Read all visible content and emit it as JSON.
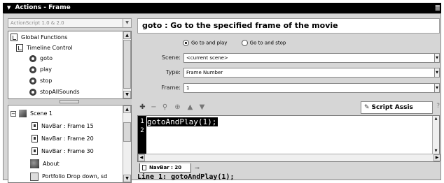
{
  "panel": {
    "title": "Actions - Frame",
    "options_glyph": "≣"
  },
  "toolbox": {
    "version_select": "ActionScript 1.0 & 2.0",
    "items": [
      {
        "label": "Global Functions",
        "icon": "book-icon"
      },
      {
        "label": "Timeline Control",
        "icon": "book-icon"
      },
      {
        "label": "goto",
        "icon": "action-icon"
      },
      {
        "label": "play",
        "icon": "action-icon"
      },
      {
        "label": "stop",
        "icon": "action-icon"
      },
      {
        "label": "stopAllSounds",
        "icon": "action-icon"
      }
    ]
  },
  "script_nav": {
    "items": [
      {
        "label": "Scene 1",
        "icon": "scene-icon"
      },
      {
        "label": "NavBar : Frame 15",
        "icon": "frame-icon"
      },
      {
        "label": "NavBar : Frame 20",
        "icon": "frame-icon"
      },
      {
        "label": "NavBar : Frame 30",
        "icon": "frame-icon"
      },
      {
        "label": "About",
        "icon": "movieclip-icon"
      },
      {
        "label": "Portfolio Drop down, sd",
        "icon": "button-icon"
      }
    ]
  },
  "assist": {
    "header": "goto : Go to the specified frame of the movie",
    "radio_play": "Go to and play",
    "radio_stop": "Go to and stop",
    "scene_label": "Scene:",
    "scene_value": "<current scene>",
    "type_label": "Type:",
    "type_value": "Frame Number",
    "frame_label": "Frame:",
    "frame_value": "1"
  },
  "toolbar": {
    "script_assist_label": "Script Assis"
  },
  "editor": {
    "line_numbers": [
      "1",
      "2"
    ],
    "line1": "gotoAndPlay(1);"
  },
  "tab": {
    "label": "NavBar : 20"
  },
  "status": "Line 1: gotoAndPlay(1);"
}
